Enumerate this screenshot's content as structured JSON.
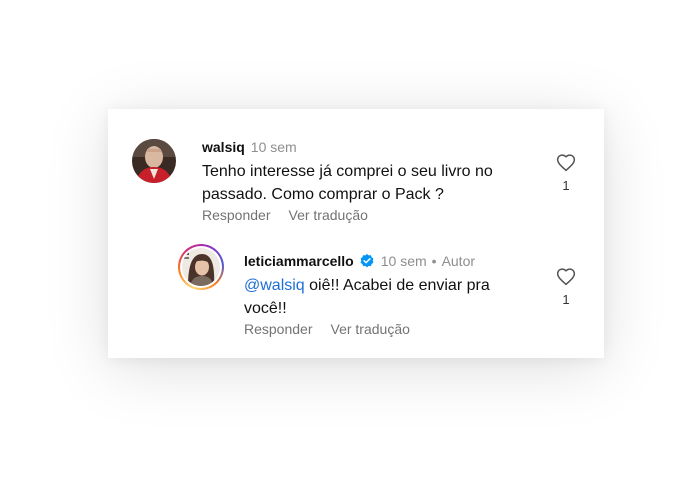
{
  "comments": [
    {
      "username": "walsiq",
      "time": "10 sem",
      "text": "Tenho interesse já comprei o seu livro no passado. Como comprar o Pack ?",
      "actions": {
        "reply": "Responder",
        "translate": "Ver tradução"
      },
      "likes": "1",
      "avatar_icon": "profile-photo-man"
    }
  ],
  "replies": [
    {
      "username": "leticiammarcello",
      "verified": true,
      "time": "10 sem",
      "separator": "•",
      "author_badge": "Autor",
      "mention": "@walsiq",
      "text": " oiê!! Acabei de enviar pra você!!",
      "actions": {
        "reply": "Responder",
        "translate": "Ver tradução"
      },
      "likes": "1",
      "avatar_icon": "profile-photo-woman-story-ring"
    }
  ],
  "colors": {
    "mention": "#1d6fd6",
    "verified": "#0095f6",
    "muted": "#8e8e8e"
  }
}
